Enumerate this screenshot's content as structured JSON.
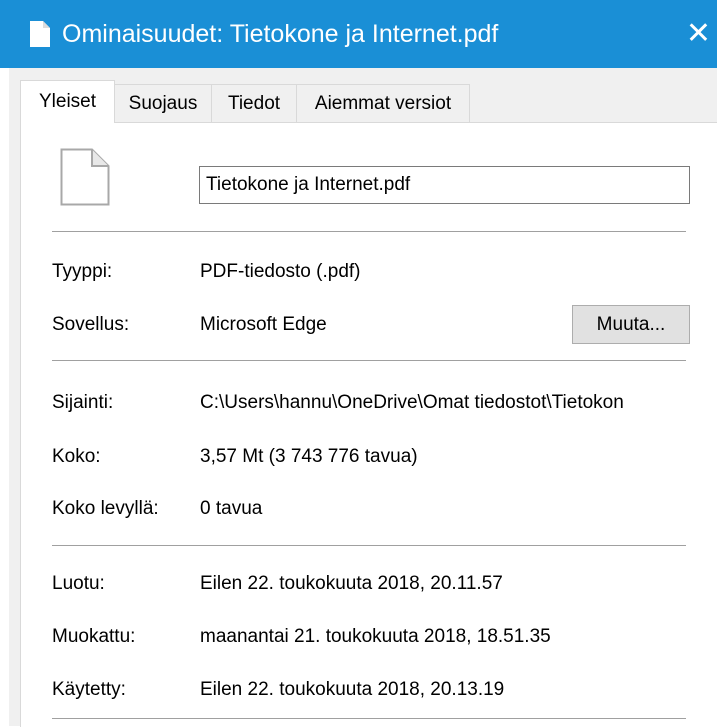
{
  "window": {
    "title": "Ominaisuudet: Tietokone ja Internet.pdf",
    "close_glyph": "✕",
    "colors": {
      "titlebar": "#1a8fd6",
      "dialog_bg": "#f0f0f0"
    }
  },
  "tabs": [
    {
      "label": "Yleiset",
      "active": true
    },
    {
      "label": "Suojaus",
      "active": false
    },
    {
      "label": "Tiedot",
      "active": false
    },
    {
      "label": "Aiemmat versiot",
      "active": false
    }
  ],
  "file": {
    "icon": "document-icon",
    "name": "Tietokone ja Internet.pdf"
  },
  "type_section": {
    "type_label": "Tyyppi:",
    "type_value": "PDF-tiedosto (.pdf)",
    "app_label": "Sovellus:",
    "app_value": "Microsoft Edge",
    "change_button": "Muuta..."
  },
  "location_section": {
    "location_label": "Sijainti:",
    "location_value": "C:\\Users\\hannu\\OneDrive\\Omat tiedostot\\Tietokon",
    "size_label": "Koko:",
    "size_value": "3,57 Mt (3 743 776 tavua)",
    "disk_size_label": "Koko levyllä:",
    "disk_size_value": "0 tavua"
  },
  "dates_section": {
    "created_label": "Luotu:",
    "created_value": "Eilen 22. toukokuuta 2018, 20.11.57",
    "modified_label": "Muokattu:",
    "modified_value": "maanantai 21. toukokuuta 2018, 18.51.35",
    "accessed_label": "Käytetty:",
    "accessed_value": "Eilen 22. toukokuuta 2018, 20.13.19"
  }
}
